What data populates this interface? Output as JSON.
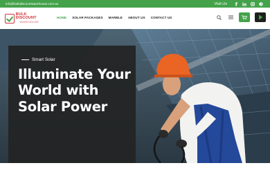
{
  "topbar": {
    "email": "info@bulkdiscountwarehouse.com.au",
    "visit_label": "Visit Us",
    "socials": [
      "facebook-icon",
      "linkedin-icon",
      "instagram-icon",
      "pinterest-icon"
    ]
  },
  "logo": {
    "line1": "BULK DISCOUNT",
    "line2": "WAREHOUSE"
  },
  "nav": {
    "items": [
      {
        "label": "HOME",
        "active": true
      },
      {
        "label": "SOLAR PACKAGES",
        "active": false
      },
      {
        "label": "MARBLE",
        "active": false
      },
      {
        "label": "ABOUT US",
        "active": false
      },
      {
        "label": "CONTACT US",
        "active": false
      }
    ]
  },
  "tools": {
    "icons": [
      "search-icon",
      "menu-icon",
      "cart-icon",
      "play-icon"
    ]
  },
  "hero": {
    "eyebrow": "Smart Solar",
    "headline": "Illuminate Your World with Solar Power"
  },
  "colors": {
    "brand_green": "#44a24a",
    "brand_red": "#d13239",
    "dark": "#1d1f1d"
  }
}
